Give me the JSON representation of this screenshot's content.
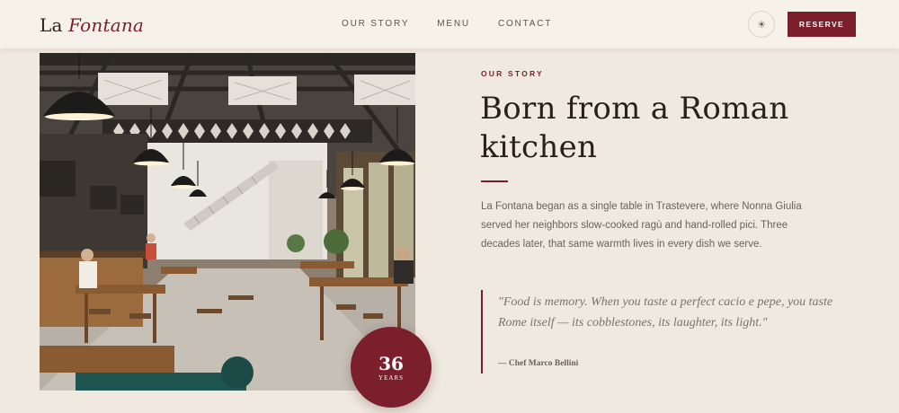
{
  "brand": {
    "name_plain": "La",
    "name_accent": "Fontana"
  },
  "nav": {
    "links": [
      {
        "label": "OUR STORY"
      },
      {
        "label": "MENU"
      },
      {
        "label": "CONTACT"
      }
    ],
    "theme_toggle_icon": "sun-icon",
    "theme_toggle_glyph": "☀",
    "reserve_label": "RESERVE"
  },
  "hero_image": {
    "description_icon": "restaurant-interior-photo"
  },
  "badge": {
    "number": "36",
    "label": "YEARS"
  },
  "story": {
    "eyebrow": "OUR STORY",
    "headline": "Born from a Roman kitchen",
    "intro": "La Fontana began as a single table in Trastevere, where Nonna Giulia served her neighbors slow-cooked ragù and hand-rolled pici. Three decades later, that same warmth lives in every dish we serve.",
    "quote": "\"Food is memory. When you taste a perfect cacio e pepe, you taste Rome itself — its cobblestones, its laughter, its light.\"",
    "cite": "— Chef Marco Bellini"
  },
  "colors": {
    "accent": "#7a1f2b",
    "background": "#f0e9df",
    "nav_background": "#f6f1e9",
    "text_dark": "#2a1f1a",
    "text_muted": "#6c6159"
  }
}
